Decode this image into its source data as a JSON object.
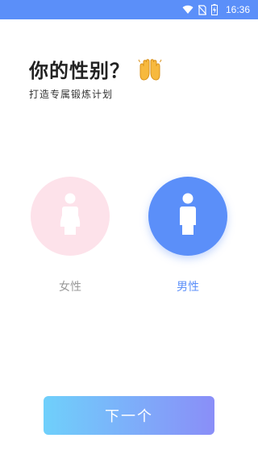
{
  "status_bar": {
    "time": "16:36",
    "icons": [
      "wifi-icon",
      "no-sim-icon",
      "battery-charging-icon"
    ]
  },
  "header": {
    "title": "你的性别？",
    "title_emoji": "raised-hands-icon",
    "subtitle": "打造专属锻炼计划"
  },
  "gender_options": [
    {
      "label": "女性",
      "icon": "female-figure-icon",
      "selected": false
    },
    {
      "label": "男性",
      "icon": "male-figure-icon",
      "selected": true
    }
  ],
  "next_button": {
    "label": "下一个"
  },
  "colors": {
    "accent": "#5b8ff9",
    "female_bg": "#fde2ea",
    "unselected_text": "#999999",
    "button_gradient_start": "#6fd0fb",
    "button_gradient_end": "#8a8ef8"
  }
}
